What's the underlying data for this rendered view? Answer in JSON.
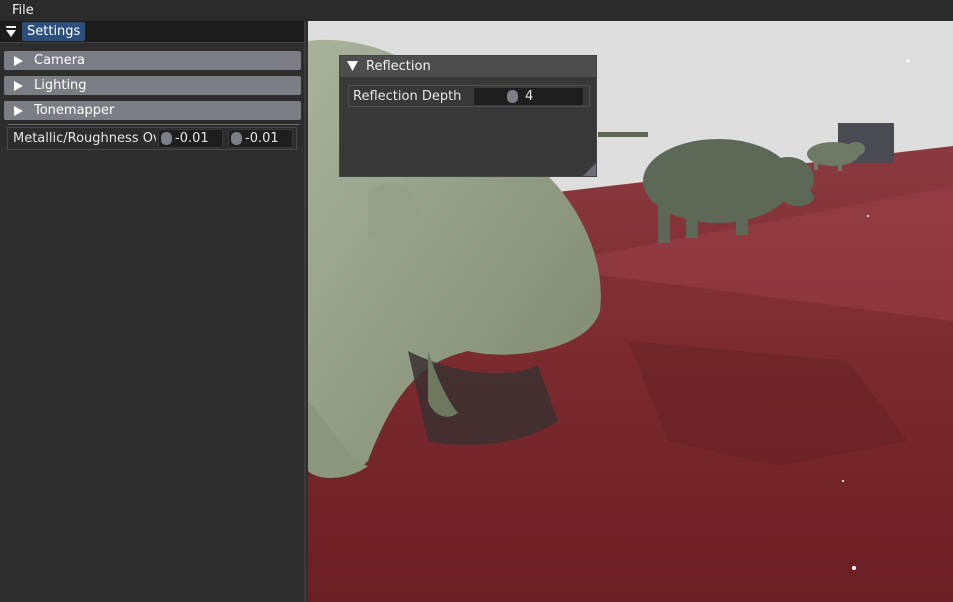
{
  "menubar": {
    "file_label": "File"
  },
  "settings_panel": {
    "tab_label": "Settings",
    "headers": [
      {
        "label": "Camera"
      },
      {
        "label": "Lighting"
      },
      {
        "label": "Tonemapper"
      }
    ],
    "metallic_roughness": {
      "label": "Metallic/Roughness Ove",
      "metallic_value": "-0.01",
      "roughness_value": "-0.01"
    }
  },
  "reflection_window": {
    "title": "Reflection",
    "depth_label": "Reflection Depth",
    "depth_value": "4"
  },
  "colors": {
    "header_bg": "#7b7d85",
    "tab_active": "#2d4f7c",
    "floor": "#7a2a2e",
    "model": "#8f9a82"
  }
}
